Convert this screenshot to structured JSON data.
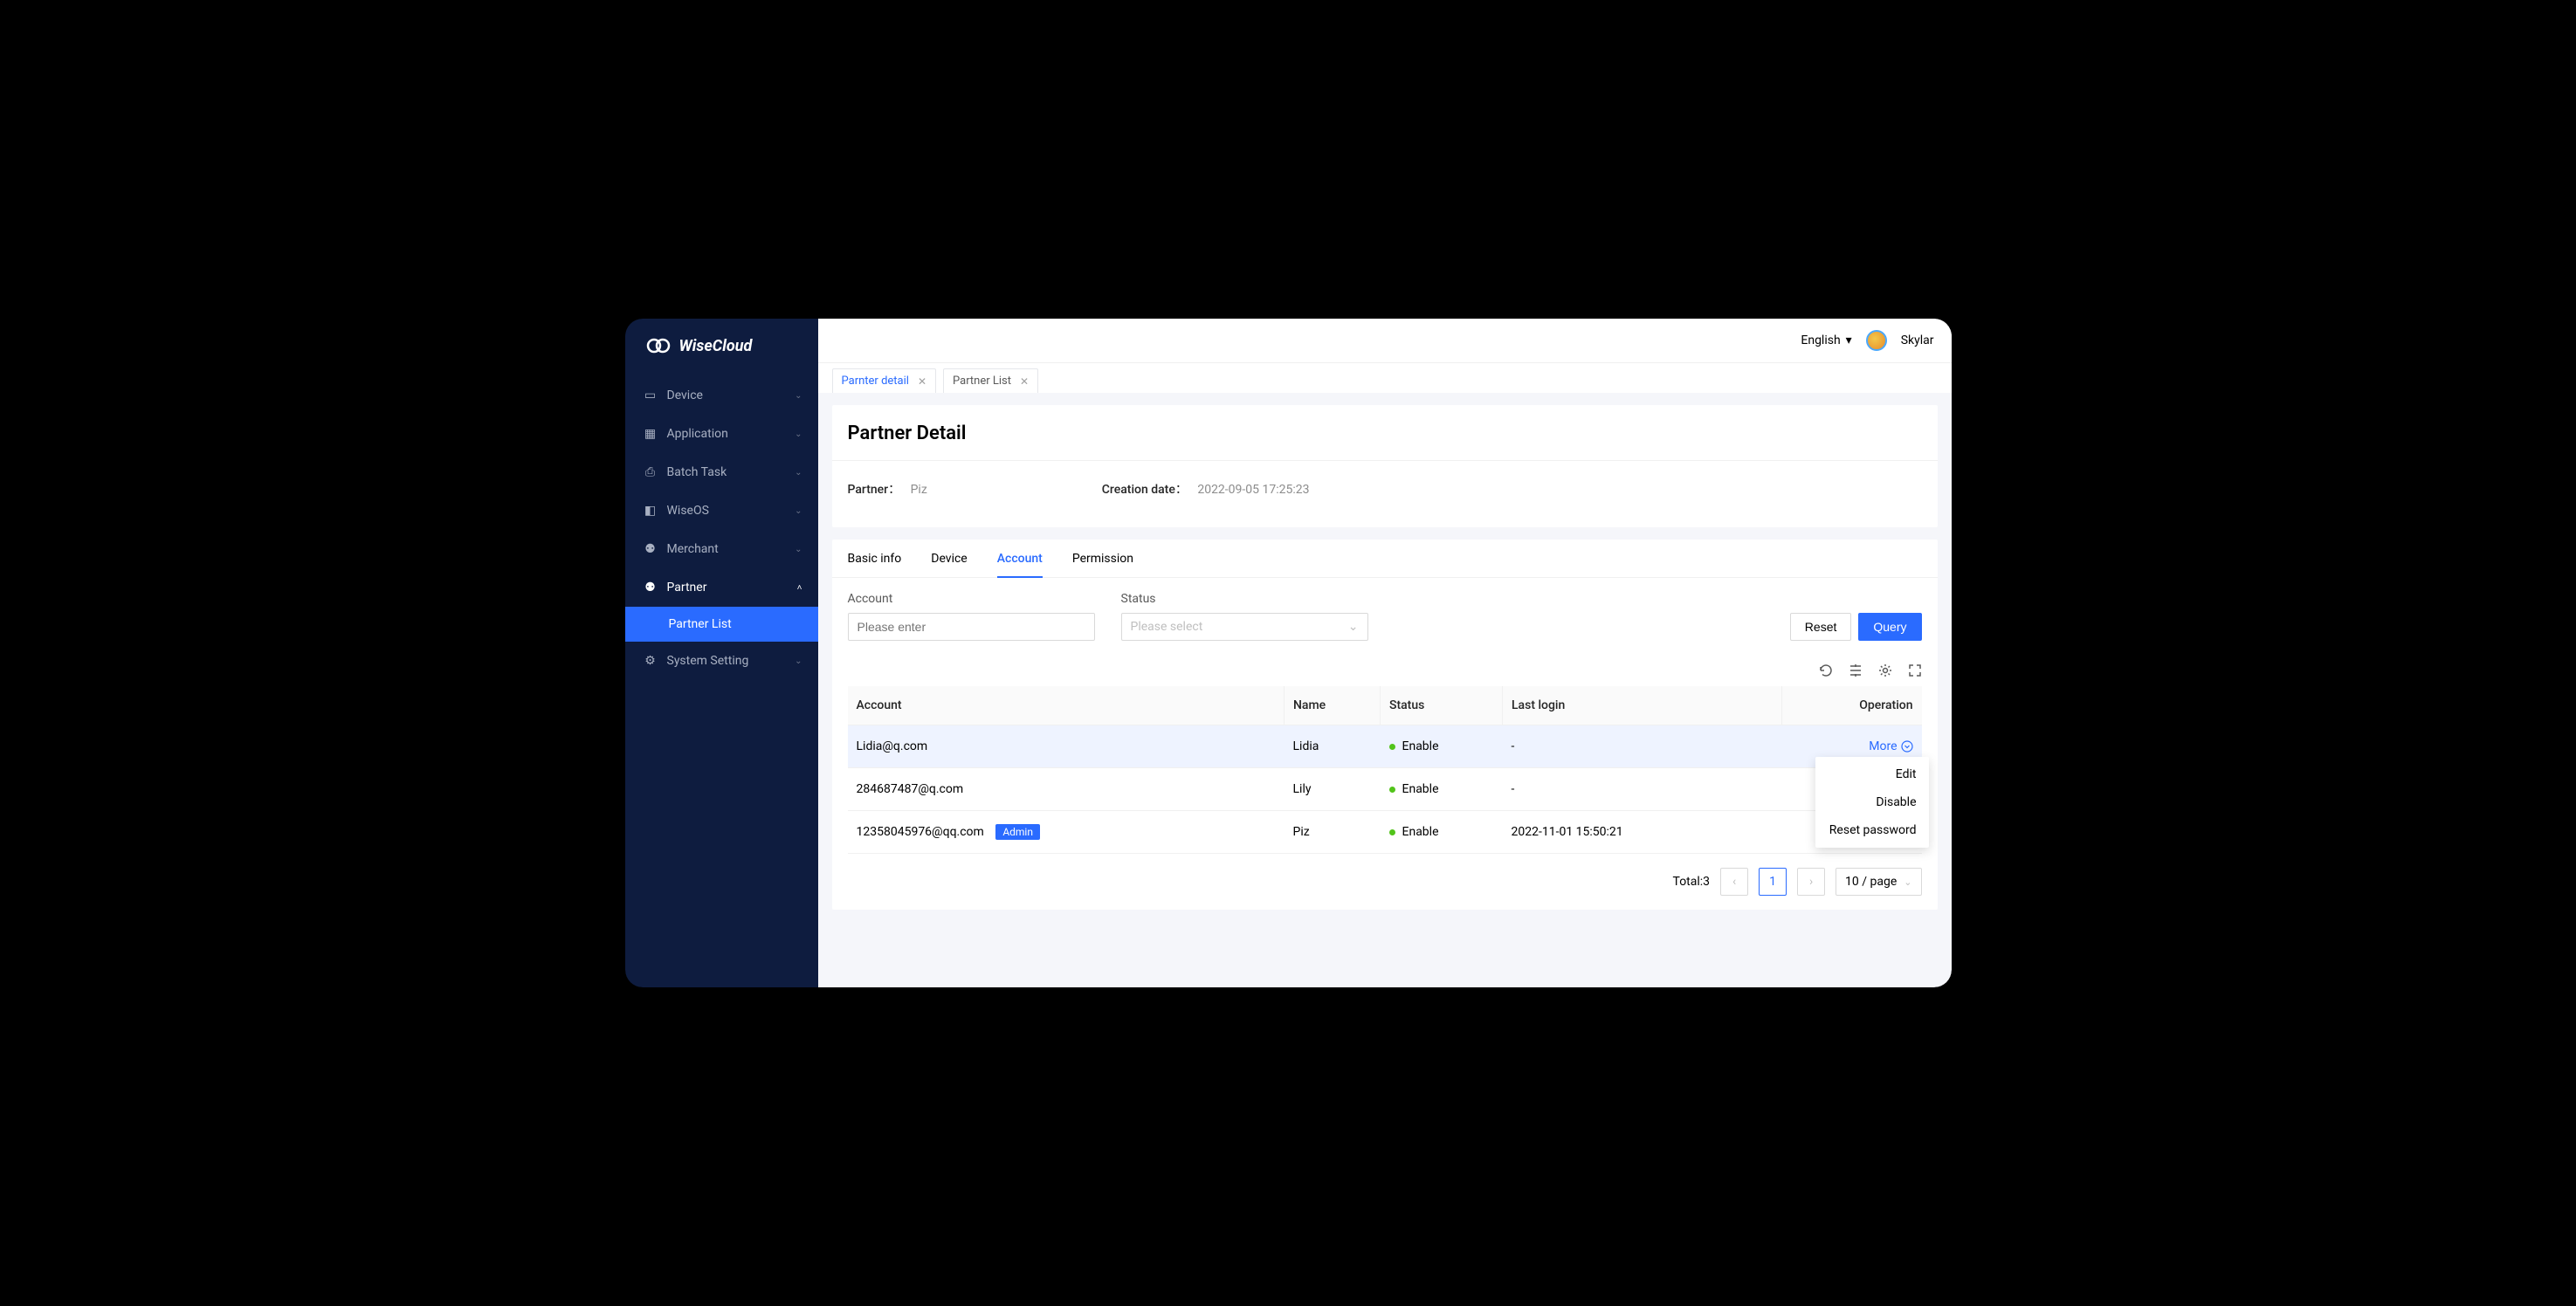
{
  "brand": {
    "name": "WiseCloud"
  },
  "topbar": {
    "language": "English",
    "username": "Skylar"
  },
  "sidebar": {
    "items": [
      {
        "label": "Device"
      },
      {
        "label": "Application"
      },
      {
        "label": "Batch Task"
      },
      {
        "label": "WiseOS"
      },
      {
        "label": "Merchant"
      },
      {
        "label": "Partner"
      },
      {
        "label": "System Setting"
      }
    ],
    "subitem": "Partner List"
  },
  "tabs": [
    {
      "label": "Parnter detail",
      "active": true
    },
    {
      "label": "Partner List",
      "active": false
    }
  ],
  "page": {
    "title": "Partner Detail",
    "partner_label": "Partner：",
    "partner_value": "Piz",
    "creation_label": "Creation date：",
    "creation_value": "2022-09-05 17:25:23"
  },
  "detail_tabs": [
    "Basic info",
    "Device",
    "Account",
    "Permission"
  ],
  "filters": {
    "account_label": "Account",
    "account_placeholder": "Please enter",
    "status_label": "Status",
    "status_placeholder": "Please select",
    "reset": "Reset",
    "query": "Query"
  },
  "table": {
    "headers": [
      "Account",
      "Name",
      "Status",
      "Last login",
      "Operation"
    ],
    "rows": [
      {
        "account": "Lidia@q.com",
        "name": "Lidia",
        "status": "Enable",
        "last_login": "-",
        "admin": false
      },
      {
        "account": "284687487@q.com",
        "name": "Lily",
        "status": "Enable",
        "last_login": "-",
        "admin": false
      },
      {
        "account": "12358045976@qq.com",
        "name": "Piz",
        "status": "Enable",
        "last_login": "2022-11-01 15:50:21",
        "admin": true
      }
    ],
    "admin_badge": "Admin",
    "more": "More"
  },
  "dropdown": [
    "Edit",
    "Disable",
    "Reset password"
  ],
  "pagination": {
    "total_label": "Total:3",
    "current": "1",
    "page_size": "10 / page"
  }
}
